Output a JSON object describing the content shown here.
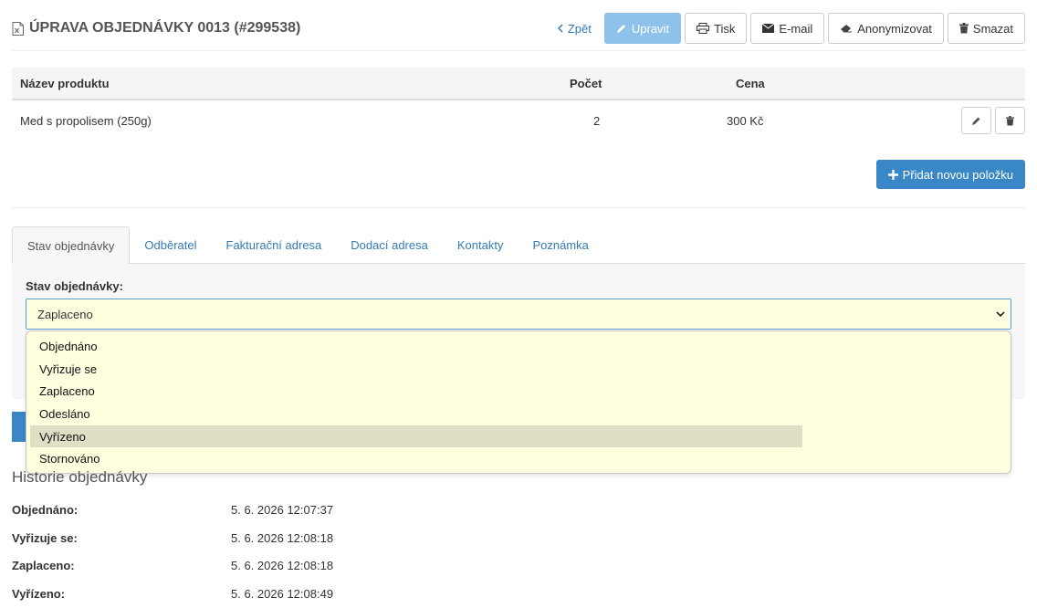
{
  "header": {
    "title": "ÚPRAVA OBJEDNÁVKY 0013 (#299538)",
    "back_label": "Zpět",
    "edit_label": "Upravit",
    "print_label": "Tisk",
    "email_label": "E-mail",
    "anonymize_label": "Anonymizovat",
    "delete_label": "Smazat"
  },
  "products": {
    "columns": [
      "Název produktu",
      "Počet",
      "Cena"
    ],
    "rows": [
      {
        "name": "Med s propolisem (250g)",
        "count": "2",
        "price": "300 Kč"
      }
    ],
    "add_label": "Přidat novou položku"
  },
  "tabs": [
    {
      "label": "Stav objednávky",
      "active": true
    },
    {
      "label": "Odběratel"
    },
    {
      "label": "Fakturační adresa"
    },
    {
      "label": "Dodací adresa"
    },
    {
      "label": "Kontakty"
    },
    {
      "label": "Poznámka"
    }
  ],
  "status": {
    "label": "Stav objednávky:",
    "selected": "Zaplaceno",
    "options": [
      "Objednáno",
      "Vyřizuje se",
      "Zaplaceno",
      "Odesláno",
      "Vyřízeno",
      "Stornováno"
    ],
    "hovered_index": 4
  },
  "history": {
    "title": "Historie objednávky",
    "entries": [
      {
        "label": "Objednáno:",
        "time": "5. 6. 2026 12:07:37"
      },
      {
        "label": "Vyřizuje se:",
        "time": "5. 6. 2026 12:08:18"
      },
      {
        "label": "Zaplaceno:",
        "time": "5. 6. 2026 12:08:18"
      },
      {
        "label": "Vyřízeno:",
        "time": "5. 6. 2026 12:08:49"
      }
    ]
  },
  "colors": {
    "accent": "#3a87c8",
    "accent_light": "#8fc2ea",
    "link": "#337ab7",
    "select_bg": "#ffffe0"
  }
}
